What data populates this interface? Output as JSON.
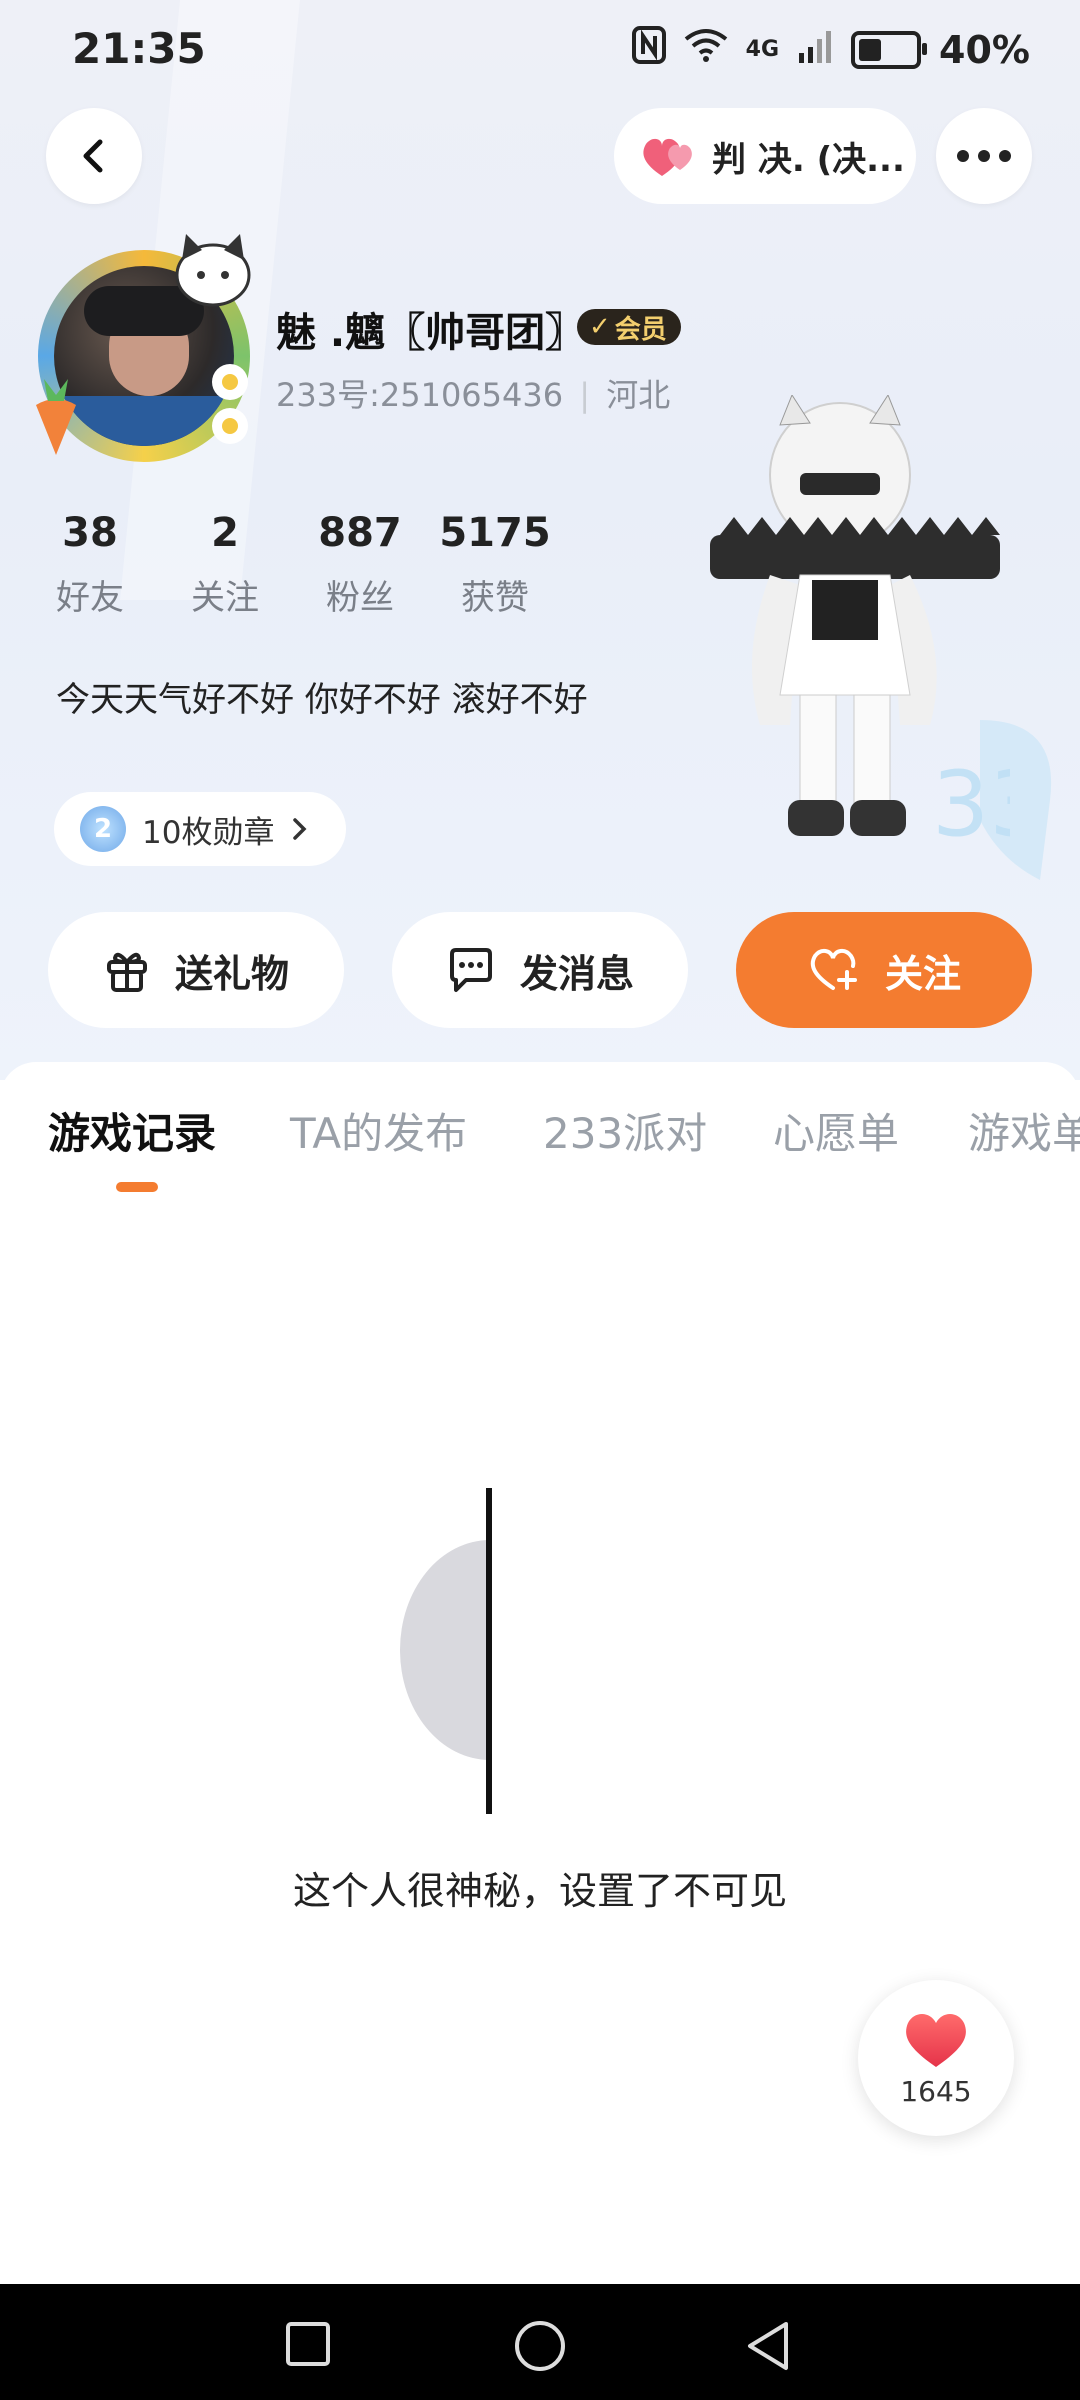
{
  "status_bar": {
    "time": "21:35",
    "network": "4G",
    "battery": "40%"
  },
  "header": {
    "back_icon": "chevron-left-icon",
    "mood_pill": "判 决. (决...",
    "more_icon": "more-dots-icon"
  },
  "profile": {
    "name": "魅 .魑〖帅哥团〗",
    "vip_badge": "会员",
    "uid": "233号:251065436",
    "location": "河北",
    "stats": [
      {
        "value": "38",
        "label": "好友"
      },
      {
        "value": "2",
        "label": "关注"
      },
      {
        "value": "887",
        "label": "粉丝"
      },
      {
        "value": "5175",
        "label": "获赞"
      }
    ],
    "signature": "今天天气好不好 你好不好 滚好不好",
    "badges_label": "10枚勋章"
  },
  "actions": {
    "gift": "送礼物",
    "message": "发消息",
    "follow": "关注"
  },
  "tabs": [
    "游戏记录",
    "TA的发布",
    "233派对",
    "心愿单",
    "游戏单"
  ],
  "content": {
    "empty_text": "这个人很神秘，设置了不可见"
  },
  "like_fab": {
    "count": "1645"
  },
  "colors": {
    "accent": "#f47c30",
    "vip_bg": "#2a241c",
    "vip_text": "#f3cf6e"
  }
}
